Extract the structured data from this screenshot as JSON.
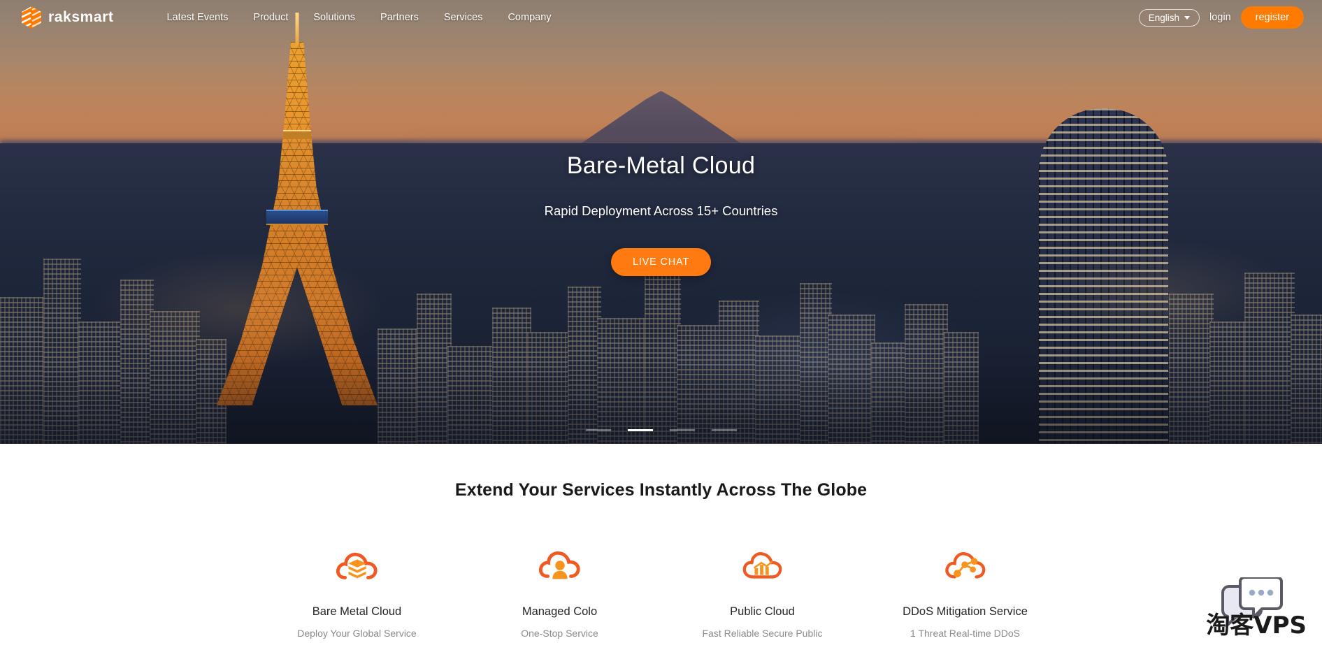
{
  "header": {
    "logo_text": "raksmart",
    "logo_icon": "raksmart-hexagon-logo",
    "nav": [
      {
        "label": "Latest Events"
      },
      {
        "label": "Product"
      },
      {
        "label": "Solutions"
      },
      {
        "label": "Partners"
      },
      {
        "label": "Services"
      },
      {
        "label": "Company"
      }
    ],
    "language": "English",
    "language_caret_icon": "chevron-down-icon",
    "login_label": "login",
    "register_label": "register"
  },
  "hero": {
    "title": "Bare-Metal Cloud",
    "subtitle": "Rapid Deployment Across 15+ Countries",
    "cta_label": "LIVE CHAT",
    "slides_total": 4,
    "active_slide": 2
  },
  "services": {
    "heading": "Extend Your Services Instantly Across The Globe",
    "items": [
      {
        "label": "Bare Metal Cloud",
        "desc": "Deploy Your Global Service",
        "icon": "cloud-server-stack-icon"
      },
      {
        "label": "Managed Colo",
        "desc": "One-Stop Service",
        "icon": "cloud-managed-person-icon"
      },
      {
        "label": "Public Cloud",
        "desc": "Fast Reliable Secure Public",
        "icon": "cloud-bar-chart-icon"
      },
      {
        "label": "DDoS Mitigation Service",
        "desc": "1 Threat Real-time DDoS",
        "icon": "cloud-network-nodes-icon"
      }
    ]
  },
  "widgets": {
    "chat_icon": "chat-bubbles-icon",
    "watermark_text": "淘客VPS"
  },
  "colors": {
    "accent_orange": "#ff7a00",
    "cta_orange": "#ff7a10",
    "icon_orange": "#f26722",
    "text_dark": "#1a1a1a"
  }
}
